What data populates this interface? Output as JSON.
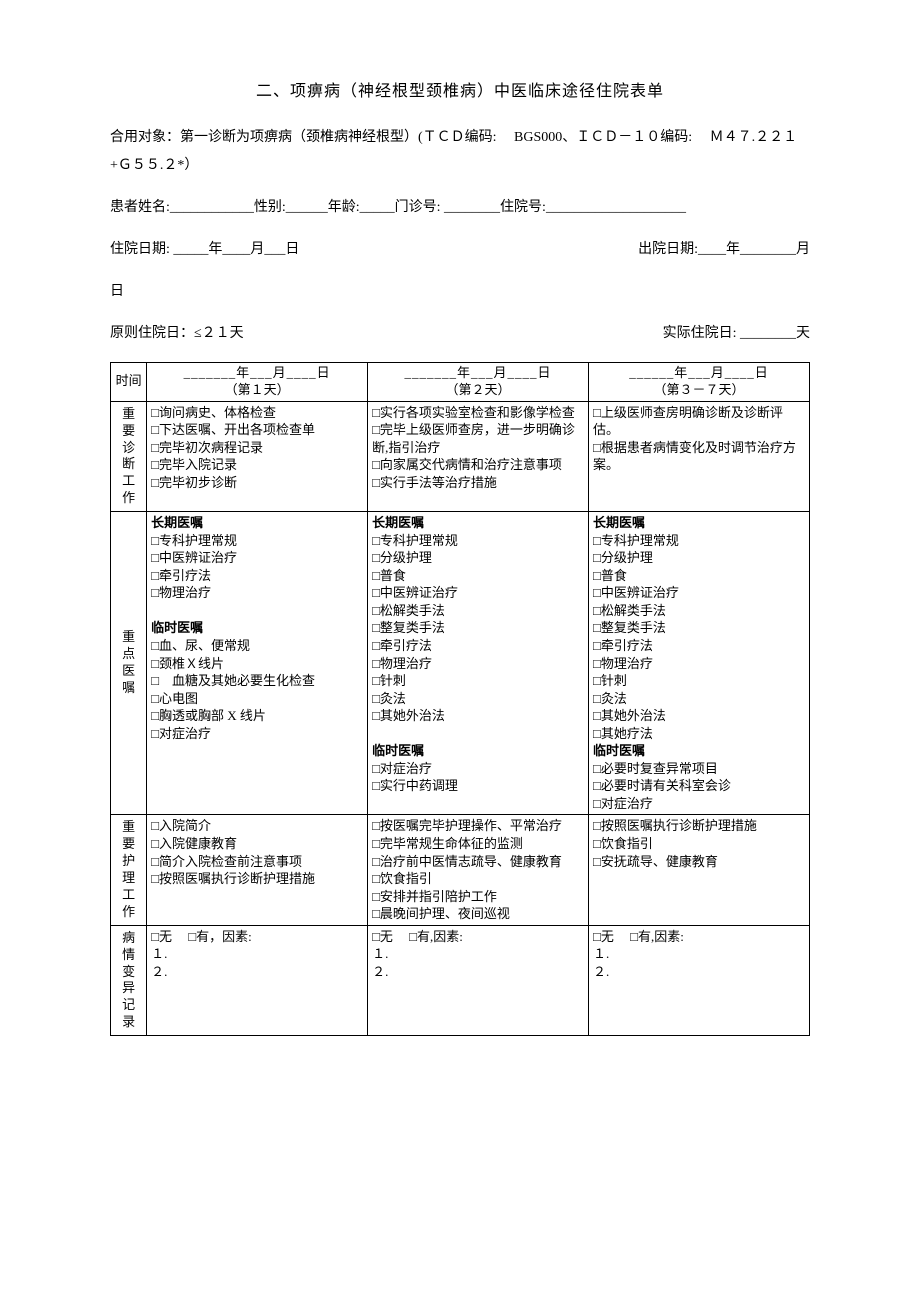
{
  "title": "二、项痹病（神经根型颈椎病）中医临床途径住院表单",
  "intro": {
    "line1": "合用对象：第一诊断为项痹病（颈椎病神经根型）(ＴＣＤ编码:　 BGS000、ＩＣＤ－１０编码:　 Ｍ４７.２２１+Ｇ５５.２*）",
    "line2": "患者姓名:____________性别:______年龄:_____门诊号: ________住院号:____________________",
    "line3_left": "住院日期: _____年____月___日",
    "line3_right": "出院日期:____年________月",
    "line4": "日",
    "line5_left": "原则住院日：≤２１天",
    "line5_right": "实际住院日: ________天"
  },
  "table": {
    "headers": {
      "row_label": "时间",
      "col1": {
        "date": "_______年___月____日",
        "sub": "（第１天）"
      },
      "col2": {
        "date": "_______年___月____日",
        "sub": "（第２天）"
      },
      "col3": {
        "date": "______年___月____日",
        "sub": "（第３－７天）"
      }
    },
    "rows": {
      "r1_label": "重要诊断工作",
      "r1_c1": [
        "□询问病史、体格检查",
        "□下达医嘱、开出各项检查单",
        "□完毕初次病程记录",
        "□完毕入院记录",
        "□完毕初步诊断"
      ],
      "r1_c2": [
        "□实行各项实验室检查和影像学检查",
        "□完毕上级医师查房，进一步明确诊断,指引治疗",
        "□向家属交代病情和治疗注意事项",
        "□实行手法等治疗措施"
      ],
      "r1_c3": [
        "□上级医师查房明确诊断及诊断评估。",
        "□根据患者病情变化及时调节治疗方案。"
      ],
      "r2_label": "重点医嘱",
      "r2_c1": [
        "长期医嘱",
        "□专科护理常规",
        "□中医辨证治疗",
        "□牵引疗法",
        "□物理治疗",
        "",
        "临时医嘱",
        "□血、尿、便常规",
        "□颈椎Ｘ线片",
        "□　血糖及其她必要生化检查",
        "□心电图",
        "□胸透或胸部 X 线片",
        "□对症治疗"
      ],
      "r2_c2": [
        "长期医嘱",
        "□专科护理常规",
        "□分级护理",
        "□普食",
        "□中医辨证治疗",
        "□松解类手法",
        "□整复类手法",
        "□牵引疗法",
        "□物理治疗",
        "□针刺",
        "□灸法",
        "□其她外治法",
        "",
        "临时医嘱",
        "□对症治疗",
        "□实行中药调理"
      ],
      "r2_c3": [
        "长期医嘱",
        "□专科护理常规",
        "□分级护理",
        "□普食",
        "□中医辨证治疗",
        "□松解类手法",
        "□整复类手法",
        "□牵引疗法",
        "□物理治疗",
        "□针刺",
        "□灸法",
        "□其她外治法",
        "□其她疗法",
        "临时医嘱",
        "□必要时复查异常项目",
        "□必要时请有关科室会诊",
        "□对症治疗"
      ],
      "r3_label": "重要护理工作",
      "r3_c1": [
        "□入院简介",
        "□入院健康教育",
        "□简介入院检查前注意事项",
        "□按照医嘱执行诊断护理措施"
      ],
      "r3_c2": [
        "□按医嘱完毕护理操作、平常治疗",
        "□完毕常规生命体征的监测",
        "□治疗前中医情志疏导、健康教育",
        "□饮食指引",
        "□安排并指引陪护工作",
        "□晨晚间护理、夜间巡视"
      ],
      "r3_c3": [
        "□按照医嘱执行诊断护理措施",
        "□饮食指引",
        "□安抚疏导、健康教育"
      ],
      "r4_label": "病情变异记录",
      "r4_c1": [
        "□无　 □有，因素:",
        "１.",
        "２."
      ],
      "r4_c2": [
        "□无　 □有,因素:",
        "１.",
        "２."
      ],
      "r4_c3": [
        "□无　 □有,因素:",
        "１.",
        "２."
      ]
    }
  }
}
